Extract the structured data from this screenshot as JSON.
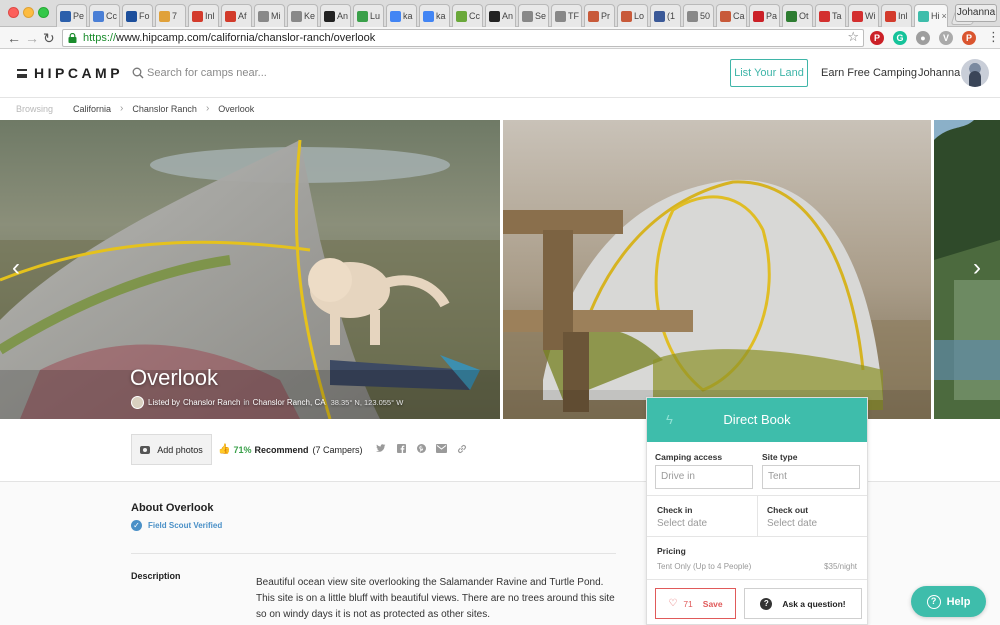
{
  "browser": {
    "profile_name": "Johanna",
    "tabs": [
      {
        "title": "Pe",
        "color": "#2b5fab"
      },
      {
        "title": "Cc",
        "color": "#4a7fd6"
      },
      {
        "title": "Fo",
        "color": "#1d4f9c"
      },
      {
        "title": "7",
        "color": "#e0a13a"
      },
      {
        "title": "Inl",
        "color": "#d33b2c"
      },
      {
        "title": "Af",
        "color": "#d23b2b"
      },
      {
        "title": "Mi",
        "color": "#888888"
      },
      {
        "title": "Ke",
        "color": "#888888"
      },
      {
        "title": "An",
        "color": "#222222"
      },
      {
        "title": "Lu",
        "color": "#3aa04a"
      },
      {
        "title": "ka",
        "color": "#4285f4"
      },
      {
        "title": "ka",
        "color": "#4285f4"
      },
      {
        "title": "Cc",
        "color": "#6aa83a"
      },
      {
        "title": "An",
        "color": "#222222"
      },
      {
        "title": "Se",
        "color": "#888888"
      },
      {
        "title": "TF",
        "color": "#888888"
      },
      {
        "title": "Pr",
        "color": "#c85a3a"
      },
      {
        "title": "Lo",
        "color": "#c85a3a"
      },
      {
        "title": "(1",
        "color": "#3b5998"
      },
      {
        "title": "50",
        "color": "#888888"
      },
      {
        "title": "Ca",
        "color": "#c85a3a"
      },
      {
        "title": "Pa",
        "color": "#cb2027"
      },
      {
        "title": "Ot",
        "color": "#2e7d32"
      },
      {
        "title": "Ta",
        "color": "#d3302f"
      },
      {
        "title": "Wi",
        "color": "#d32f2f"
      },
      {
        "title": "Inl",
        "color": "#d33b2c"
      },
      {
        "title": "Hi",
        "color": "#3ebdab",
        "active": true
      }
    ],
    "url_scheme": "https://",
    "url_rest": "www.hipcamp.com/california/chanslor-ranch/overlook",
    "extensions": [
      {
        "name": "pinterest-icon",
        "color": "#cb2027",
        "glyph": "P"
      },
      {
        "name": "grammarly-icon",
        "color": "#15c39a",
        "glyph": "G"
      },
      {
        "name": "evernote-icon",
        "color": "#9e9e9e",
        "glyph": "●"
      },
      {
        "name": "vimeo-icon",
        "color": "#aaaaaa",
        "glyph": "V"
      },
      {
        "name": "producthunt-icon",
        "color": "#da552f",
        "glyph": "P"
      }
    ]
  },
  "header": {
    "logo": "HIPCAMP",
    "search_placeholder": "Search for camps near...",
    "list_land": "List Your Land",
    "earn": "Earn Free Camping",
    "user": "Johanna"
  },
  "breadcrumb": {
    "root": "Browsing",
    "items": [
      "California",
      "Chanslor Ranch",
      "Overlook"
    ]
  },
  "hero": {
    "title": "Overlook",
    "listed_by_label": "Listed by",
    "host": "Chanslor Ranch",
    "in_label": "in",
    "location": "Chanslor Ranch, CA",
    "coords": "38.35° N, 123.055° W",
    "prev": "‹",
    "next": "›"
  },
  "actions": {
    "add_photos": "Add photos",
    "recommend_pct": "71%",
    "recommend_label": "Recommend",
    "recommend_count": "(7 Campers)"
  },
  "about": {
    "title": "About Overlook",
    "verified": "Field Scout Verified",
    "desc_label": "Description",
    "desc_text": "Beautiful ocean view site overlooking the Salamander Ravine and Turtle Pond. This site is on a little bluff with beautiful views. There are no trees around this site so on windy days it is not as protected as other sites."
  },
  "booking": {
    "title": "Direct Book",
    "camping_access_label": "Camping access",
    "camping_access_value": "Drive in",
    "site_type_label": "Site type",
    "site_type_value": "Tent",
    "check_in_label": "Check in",
    "check_in_placeholder": "Select date",
    "check_out_label": "Check out",
    "check_out_placeholder": "Select date",
    "pricing_label": "Pricing",
    "pricing_desc": "Tent Only (Up to 4 People)",
    "pricing_value": "$35/night",
    "save_count": "71",
    "save_label": "Save",
    "ask_label": "Ask a question!"
  },
  "help": {
    "label": "Help"
  },
  "colors": {
    "accent": "#3ebdab",
    "save": "#e05a5a",
    "link": "#4a90c7",
    "recommend": "#3aa04a"
  }
}
